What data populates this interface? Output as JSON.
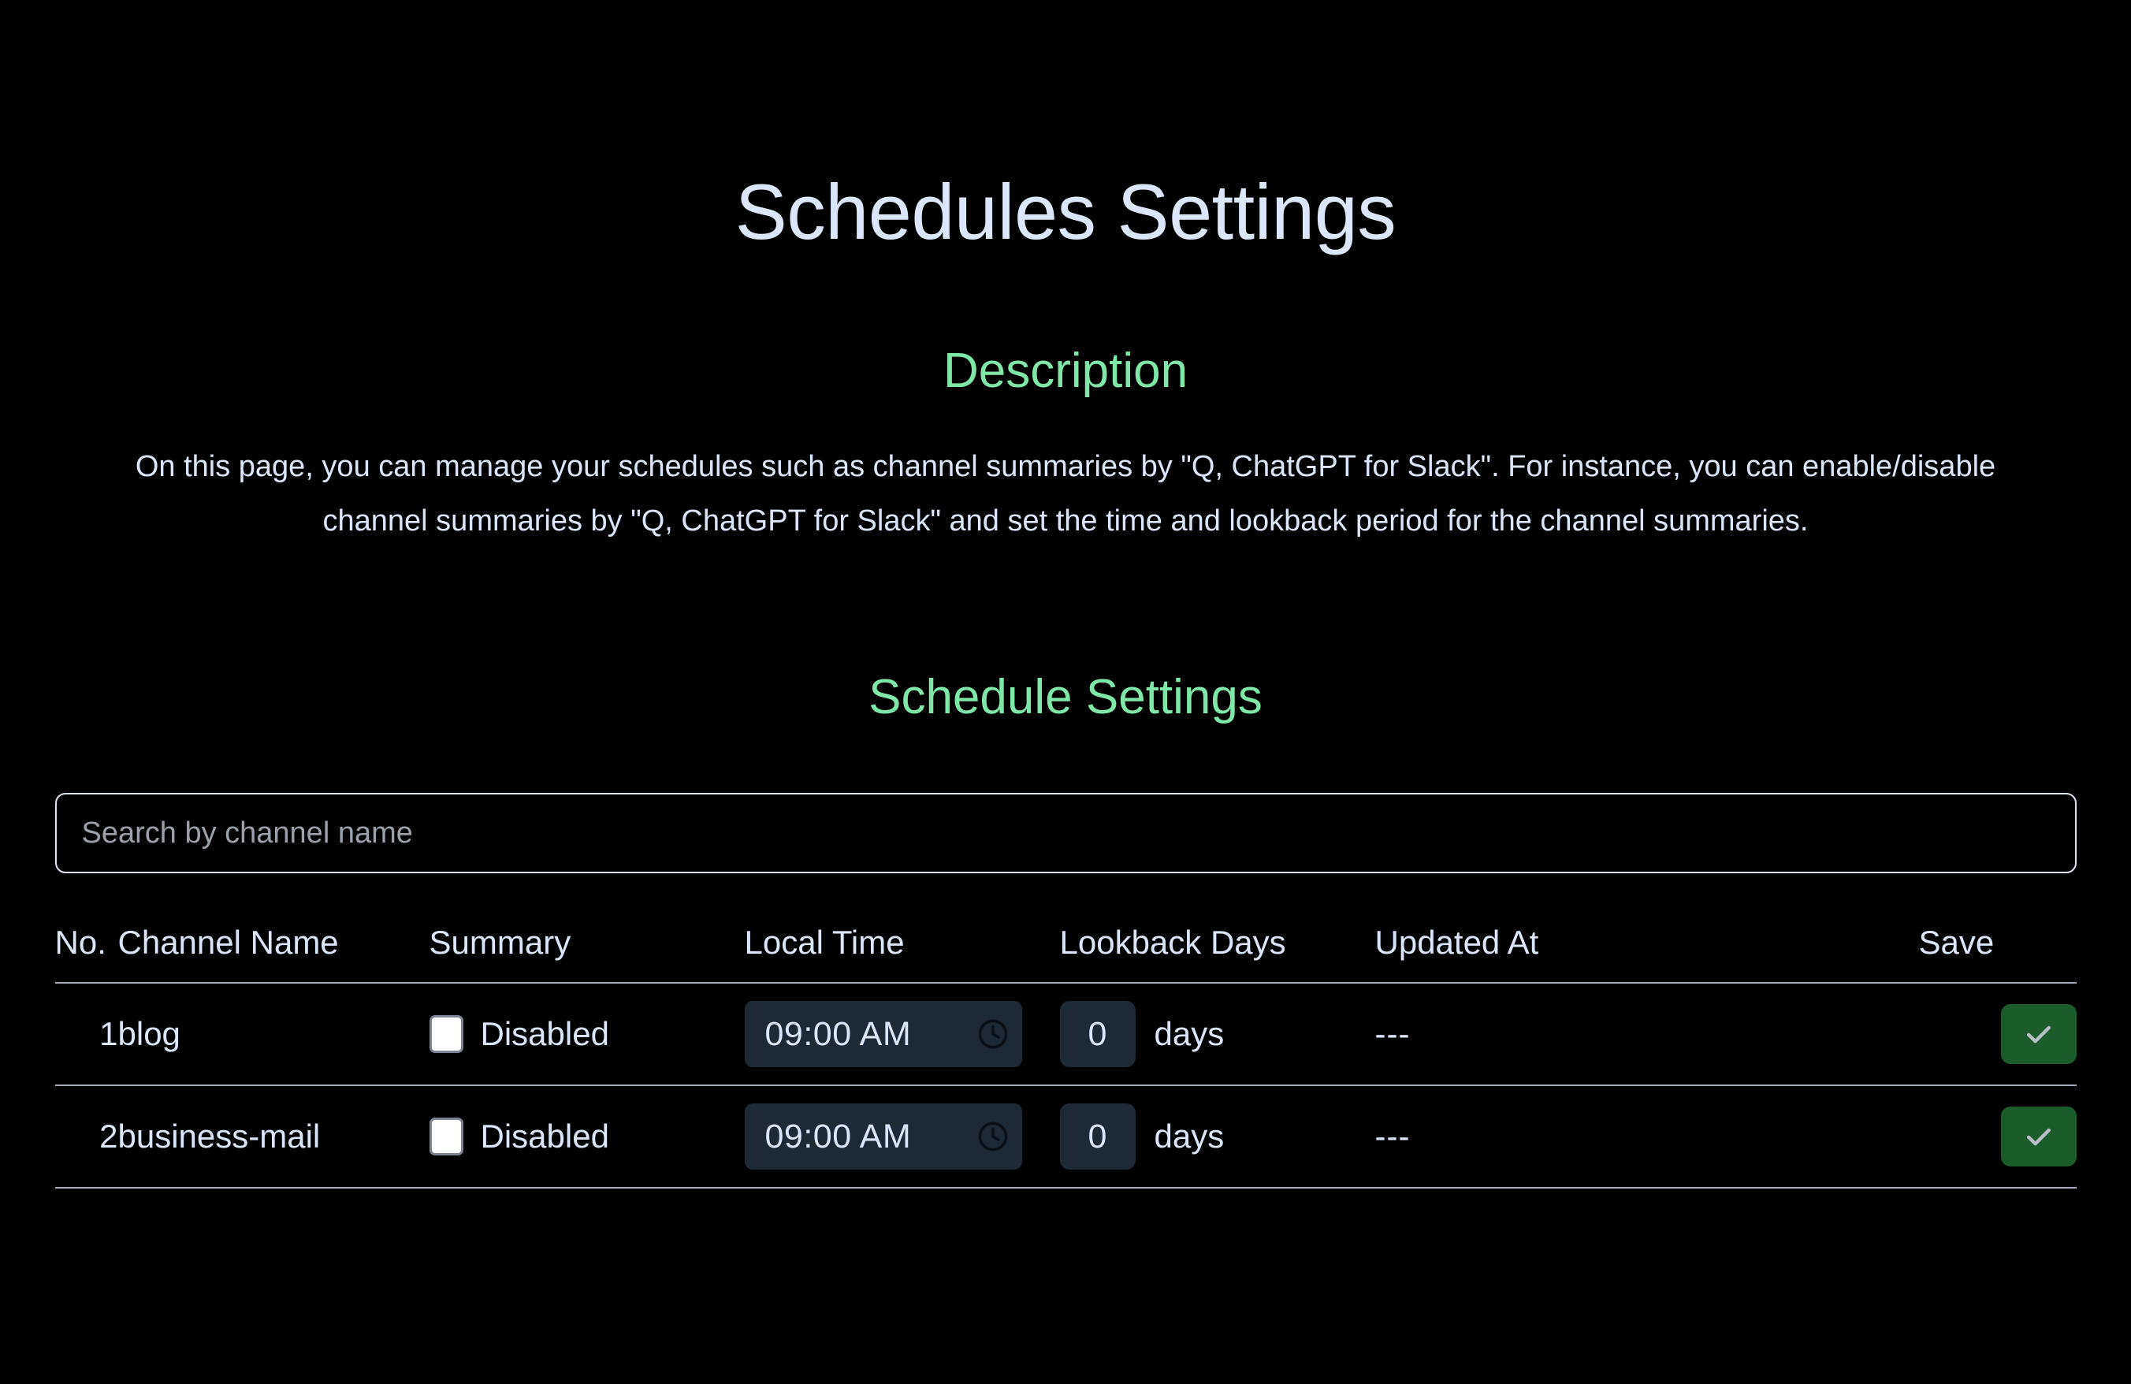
{
  "page": {
    "title": "Schedules Settings"
  },
  "description": {
    "heading": "Description",
    "body": "On this page, you can manage your schedules such as channel summaries by \"Q, ChatGPT for Slack\". For instance, you can enable/disable channel summaries by \"Q, ChatGPT for Slack\" and set the time and lookback period for the channel summaries."
  },
  "schedule_settings": {
    "heading": "Schedule Settings",
    "search": {
      "placeholder": "Search by channel name",
      "value": ""
    },
    "table": {
      "headers": {
        "no": "No.",
        "channel_name": "Channel Name",
        "summary": "Summary",
        "local_time": "Local Time",
        "lookback_days": "Lookback Days",
        "updated_at": "Updated At",
        "save": "Save"
      },
      "rows": [
        {
          "no": "1",
          "channel_name": "blog",
          "summary_checked": false,
          "summary_label": "Disabled",
          "local_time": "09:00 AM",
          "lookback_days": "0",
          "lookback_unit": "days",
          "updated_at": "---",
          "save_icon": "check-icon"
        },
        {
          "no": "2",
          "channel_name": "business-mail",
          "summary_checked": false,
          "summary_label": "Disabled",
          "local_time": "09:00 AM",
          "lookback_days": "0",
          "lookback_unit": "days",
          "updated_at": "---",
          "save_icon": "check-icon"
        }
      ]
    }
  },
  "icons": {
    "clock": "clock-icon",
    "check": "check-icon"
  },
  "colors": {
    "background": "#000000",
    "text": "#dce6fb",
    "accent_green": "#7fe8a8",
    "field_background": "#1e2936",
    "save_green": "#1a5c2b",
    "divider": "#a6aebd",
    "placeholder": "#9aa1ab"
  }
}
